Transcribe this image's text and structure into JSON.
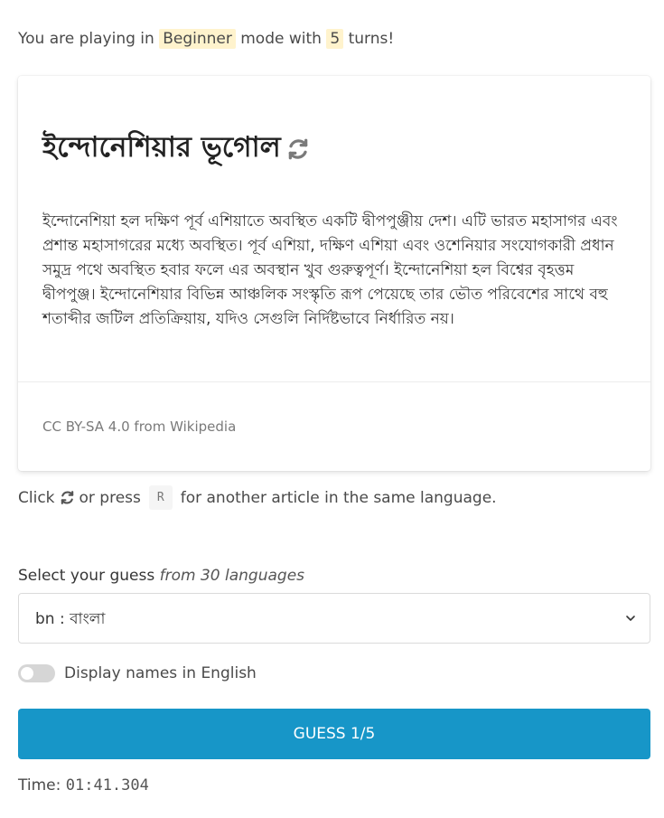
{
  "mode_line": {
    "prefix": "You are playing in",
    "mode": "Beginner",
    "middle": "mode with",
    "turns": "5",
    "suffix": "turns!"
  },
  "article": {
    "title": "ইন্দোনেশিয়ার ভূগোল",
    "body": "ইন্দোনেশিয়া হল দক্ষিণ পূর্ব এশিয়াতে অবস্থিত একটি দ্বীপপুঞ্জীয় দেশ। এটি ভারত মহাসাগর এবং প্রশান্ত মহাসাগরের মধ্যে অবস্থিত। পূর্ব এশিয়া, দক্ষিণ এশিয়া এবং ওশেনিয়ার সংযোগকারী প্রধান সমুদ্র পথে অবস্থিত হবার ফলে এর অবস্থান খুব গুরুত্বপূর্ণ। ইন্দোনেশিয়া হল বিশ্বের বৃহত্তম দ্বীপপুঞ্জ। ইন্দোনেশিয়ার বিভিন্ন আঞ্চলিক সংস্কৃতি রূপ পেয়েছে তার ভৌত পরিবেশের সাথে বহু শতাব্দীর জটিল প্রতিক্রিয়ায়, যদিও সেগুলি নির্দিষ্টভাবে নির্ধারিত নয়।",
    "credit": "CC BY-SA 4.0 from Wikipedia"
  },
  "hint": {
    "click": "Click",
    "or_press": "or press",
    "key": "R",
    "suffix": "for another article in the same language."
  },
  "guess": {
    "label": "Select your guess",
    "label_em": "from 30 languages",
    "selected": "bn : বাংলা",
    "toggle_label": "Display names in English",
    "toggle_on": false,
    "button": "GUESS 1/5"
  },
  "timer": {
    "label": "Time:",
    "value": "01:41.304"
  },
  "colors": {
    "accent": "#1796c8",
    "highlight": "#fff3cd"
  }
}
